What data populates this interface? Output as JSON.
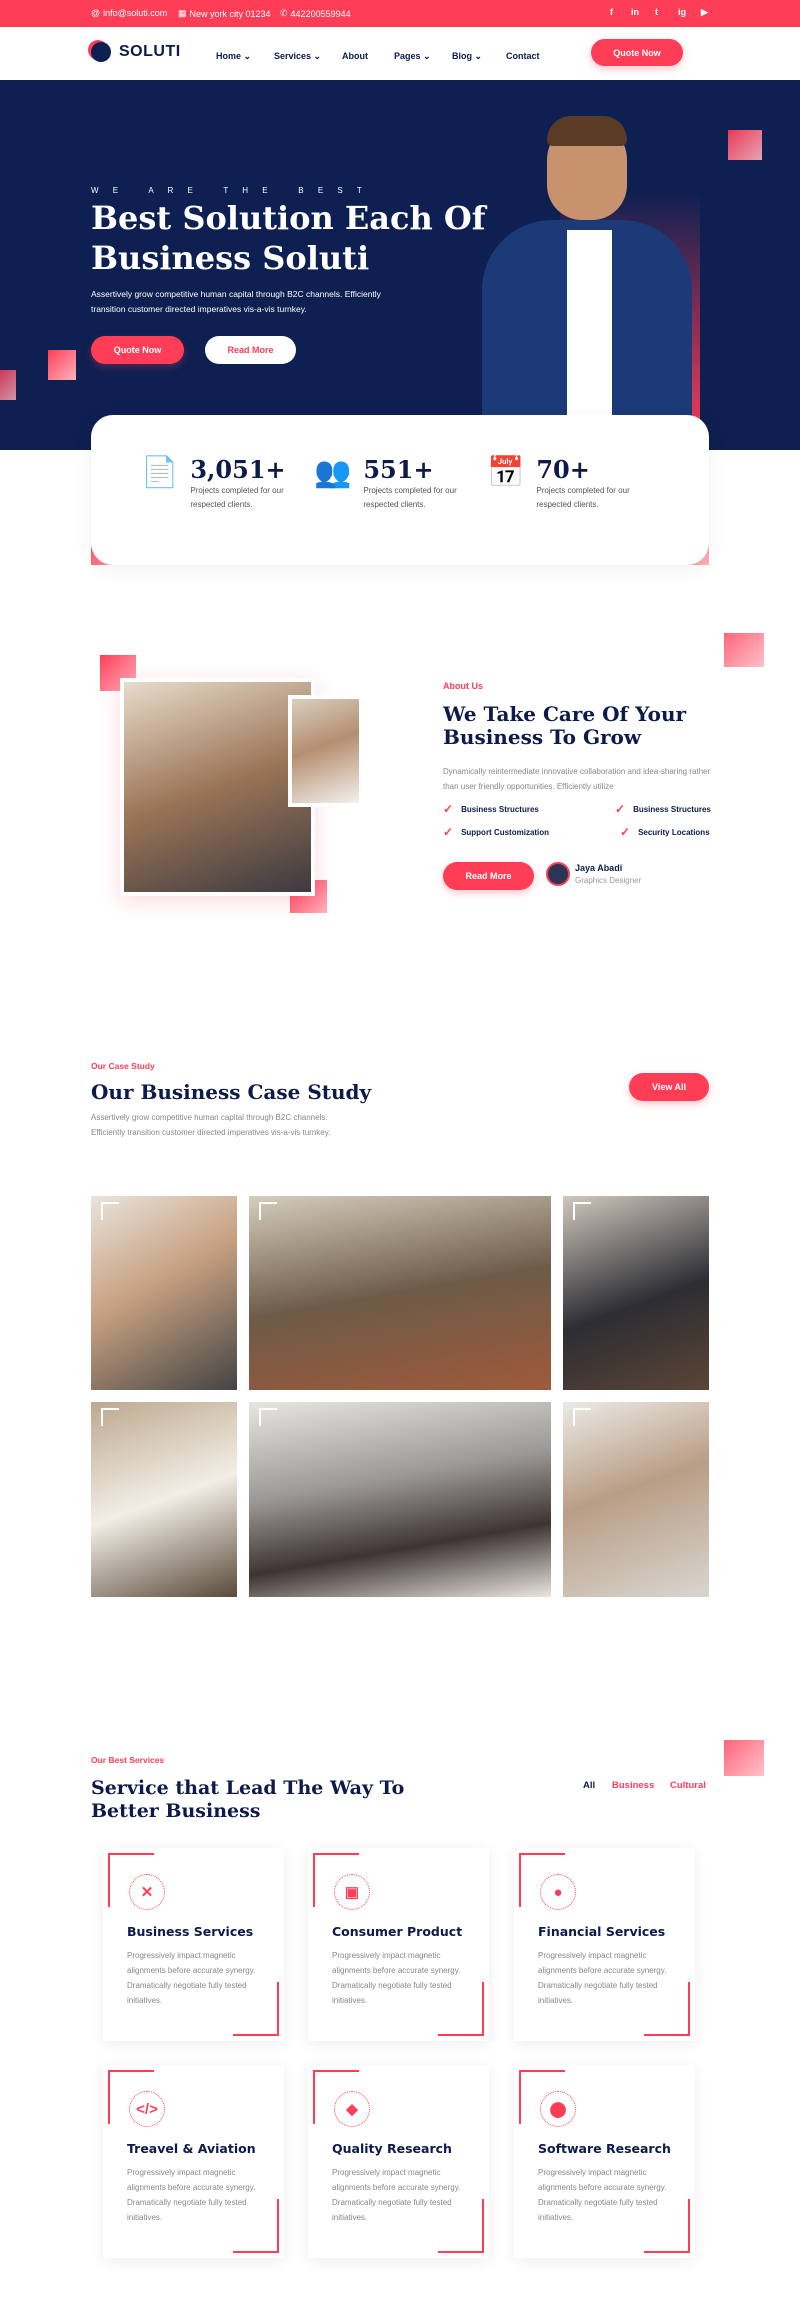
{
  "topbar": {
    "email": "info@soluti.com",
    "address": "New york city 01234",
    "phone": "442200559944",
    "social": [
      "f",
      "in",
      "t",
      "ig",
      "yt"
    ]
  },
  "nav": {
    "logo": "SOLUTI",
    "items": [
      "Home",
      "Services",
      "About",
      "Pages",
      "Blog",
      "Contact"
    ],
    "has_dropdown": [
      true,
      true,
      false,
      true,
      true,
      false
    ],
    "cta": "Quote Now"
  },
  "hero": {
    "eyebrow": "W E   A R E   T H E   B E S T",
    "title_line1": "Best Solution Each Of",
    "title_line2": "Business Soluti",
    "text": "Assertively grow competitive human capital through B2C channels. Efficiently transition customer directed imperatives vis-a-vis turnkey.",
    "primary": "Quote Now",
    "secondary": "Read More"
  },
  "stats": [
    {
      "num": "3,051+",
      "desc": "Projects completed for our respected clients.",
      "icon": "report-icon"
    },
    {
      "num": "551+",
      "desc": "Projects completed for our respected clients.",
      "icon": "team-icon"
    },
    {
      "num": "70+",
      "desc": "Projects completed for our respected clients.",
      "icon": "celebration-calendar-icon"
    }
  ],
  "about": {
    "label": "About Us",
    "title_line1": "We Take Care Of Your",
    "title_line2": "Business To Grow",
    "text": "Dynamically reintermediate innovative collaboration and idea-sharing rather than user friendly opportunities. Efficiently utilize",
    "checks": [
      "Business Structures",
      "Business Structures",
      "Support Customization",
      "Security Locations"
    ],
    "button": "Read More",
    "author_name": "Jaya Abadi",
    "author_role": "Graphics Designer"
  },
  "case": {
    "label": "Our Case Study",
    "title": "Our Business Case Study",
    "text_line1": "Assertively grow competitive human capital through B2C channels.",
    "text_line2": "Efficiently transition customer directed imperatives vis-a-vis turnkey.",
    "button": "View All"
  },
  "services": {
    "label": "Our Best Services",
    "title_line1": "Service that Lead The Way To",
    "title_line2": "Better Business",
    "tabs": [
      "All",
      "Business",
      "Cultural"
    ],
    "cards": [
      {
        "title": "Business Services",
        "icon": "tools-icon",
        "glyph": "✕",
        "desc": "Progressively impact magnetic alignments before accurate synergy. Dramatically negotiate fully tested initiatives."
      },
      {
        "title": "Consumer Product",
        "icon": "box-icon",
        "glyph": "▣",
        "desc": "Progressively impact magnetic alignments before accurate synergy. Dramatically negotiate fully tested initiatives."
      },
      {
        "title": "Financial Services",
        "icon": "headset-icon",
        "glyph": "●",
        "desc": "Progressively impact magnetic alignments before accurate synergy. Dramatically negotiate fully tested initiatives."
      },
      {
        "title": "Treavel & Aviation",
        "icon": "code-icon",
        "glyph": "</>",
        "desc": "Progressively impact magnetic alignments before accurate synergy. Dramatically negotiate fully tested initiatives."
      },
      {
        "title": "Quality Research",
        "icon": "diamond-icon",
        "glyph": "◆",
        "desc": "Progressively impact magnetic alignments before accurate synergy. Dramatically negotiate fully tested initiatives."
      },
      {
        "title": "Software Research",
        "icon": "location-pin-icon",
        "glyph": "⬤",
        "desc": "Progressively impact magnetic alignments before accurate synergy. Dramatically negotiate fully tested initiatives."
      }
    ]
  },
  "colors": {
    "accent": "#ff3d57",
    "navy": "#0e1f51"
  }
}
